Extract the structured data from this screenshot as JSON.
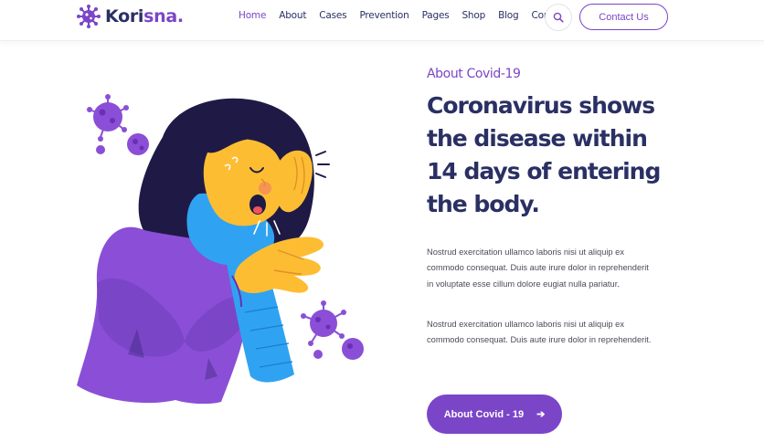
{
  "brand": {
    "part1": "Kori",
    "part2": "sna."
  },
  "nav": [
    "Home",
    "About",
    "Cases",
    "Prevention",
    "Pages",
    "Shop",
    "Blog",
    "Contact"
  ],
  "header": {
    "contact_label": "Contact Us"
  },
  "about": {
    "eyebrow": "About Covid-19",
    "heading": "Coronavirus shows the disease within 14 days of entering the body.",
    "para1": "Nostrud exercitation ullamco laboris nisi ut aliquip ex commodo consequat. Duis aute irure dolor in reprehenderit in voluptate esse cillum dolore eugiat nulla pariatur.",
    "para2": "Nostrud exercitation ullamco laboris nisi ut aliquip ex commodo consequat. Duis aute irure dolor in reprehenderit.",
    "cta_label": "About Covid - 19",
    "cta_arrow": "➔"
  },
  "icons": [
    "virus-logo-icon",
    "search-icon",
    "arrow-right-icon"
  ],
  "colors": {
    "primary": "#7b45c8",
    "navy": "#2a3063",
    "skin": "#fdbd33",
    "scarf": "#2fa3f2"
  }
}
